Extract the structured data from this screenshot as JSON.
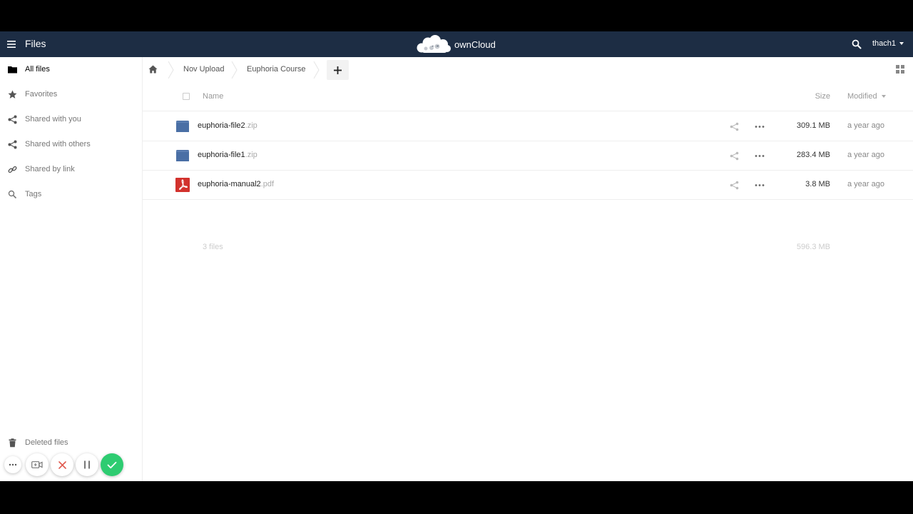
{
  "header": {
    "app_title": "Files",
    "brand": "ownCloud",
    "user": "thach1",
    "background_color": "#1d2d44"
  },
  "sidebar": {
    "items": [
      {
        "label": "All files",
        "icon": "folder-icon"
      },
      {
        "label": "Favorites",
        "icon": "star-icon"
      },
      {
        "label": "Shared with you",
        "icon": "share-icon"
      },
      {
        "label": "Shared with others",
        "icon": "share-icon"
      },
      {
        "label": "Shared by link",
        "icon": "link-icon"
      },
      {
        "label": "Tags",
        "icon": "tag-search-icon"
      },
      {
        "label": "Deleted files",
        "icon": "trash-icon"
      }
    ],
    "active_index": 0
  },
  "breadcrumb": {
    "items": [
      "Nov Upload",
      "Euphoria Course"
    ]
  },
  "table": {
    "columns": {
      "name": "Name",
      "size": "Size",
      "modified": "Modified"
    },
    "rows": [
      {
        "name": "euphoria-file2",
        "ext": ".zip",
        "size": "309.1 MB",
        "modified": "a year ago",
        "type": "archive"
      },
      {
        "name": "euphoria-file1",
        "ext": ".zip",
        "size": "283.4 MB",
        "modified": "a year ago",
        "type": "archive"
      },
      {
        "name": "euphoria-manual2",
        "ext": ".pdf",
        "size": "3.8 MB",
        "modified": "a year ago",
        "type": "pdf"
      }
    ],
    "summary": {
      "count": "3 files",
      "size": "596.3 MB"
    }
  },
  "recorder": {
    "buttons": [
      "more-icon",
      "camera-icon",
      "close-icon",
      "pause-icon",
      "check-icon"
    ]
  }
}
